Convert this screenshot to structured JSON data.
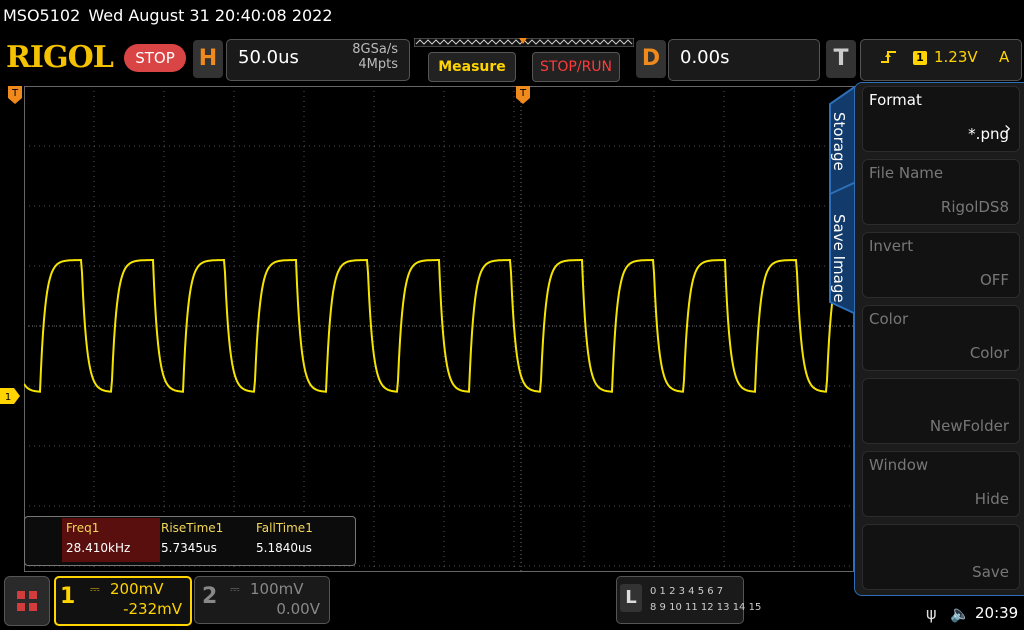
{
  "title_bar": {
    "model": "MSO5102",
    "datetime": "Wed August 31 20:40:08 2022"
  },
  "toolbar": {
    "logo": "RIGOL",
    "run_state": "STOP",
    "horizontal": {
      "letter": "H",
      "timebase": "50.0us",
      "sample_rate": "8GSa/s",
      "memory_depth": "4Mpts"
    },
    "measure_label": "Measure",
    "stop_run_label": "STOP/RUN",
    "delay": {
      "letter": "D",
      "value": "0.00s"
    },
    "trigger": {
      "letter": "T",
      "source": "1",
      "level": "1.23V",
      "mode": "A"
    }
  },
  "trace": {
    "color": "#f5e400"
  },
  "measurements": [
    {
      "label": "Freq1",
      "value": "28.410kHz"
    },
    {
      "label": "RiseTime1",
      "value": "5.7345us"
    },
    {
      "label": "FallTime1",
      "value": "5.1840us"
    }
  ],
  "side_menu": {
    "tabs": [
      "Storage",
      "Save Image"
    ],
    "items": [
      {
        "title": "Format",
        "value": "*.png"
      },
      {
        "title": "File Name",
        "value": "RigolDS8"
      },
      {
        "title": "Invert",
        "value": "OFF"
      },
      {
        "title": "Color",
        "value": "Color"
      },
      {
        "title": "",
        "value": "NewFolder"
      },
      {
        "title": "Window",
        "value": "Hide"
      },
      {
        "title": "",
        "value": "Save"
      }
    ]
  },
  "channels": [
    {
      "number": "1",
      "scale": "200mV",
      "offset": "-232mV"
    },
    {
      "number": "2",
      "scale": "100mV",
      "offset": "0.00V"
    }
  ],
  "ch1_marker_label": "1",
  "logic_analyzer": {
    "letter": "L",
    "row1": "0 1 2 3  4 5 6 7",
    "row2": "8 9 10 11 12 13 14 15"
  },
  "status": {
    "time": "20:39"
  }
}
